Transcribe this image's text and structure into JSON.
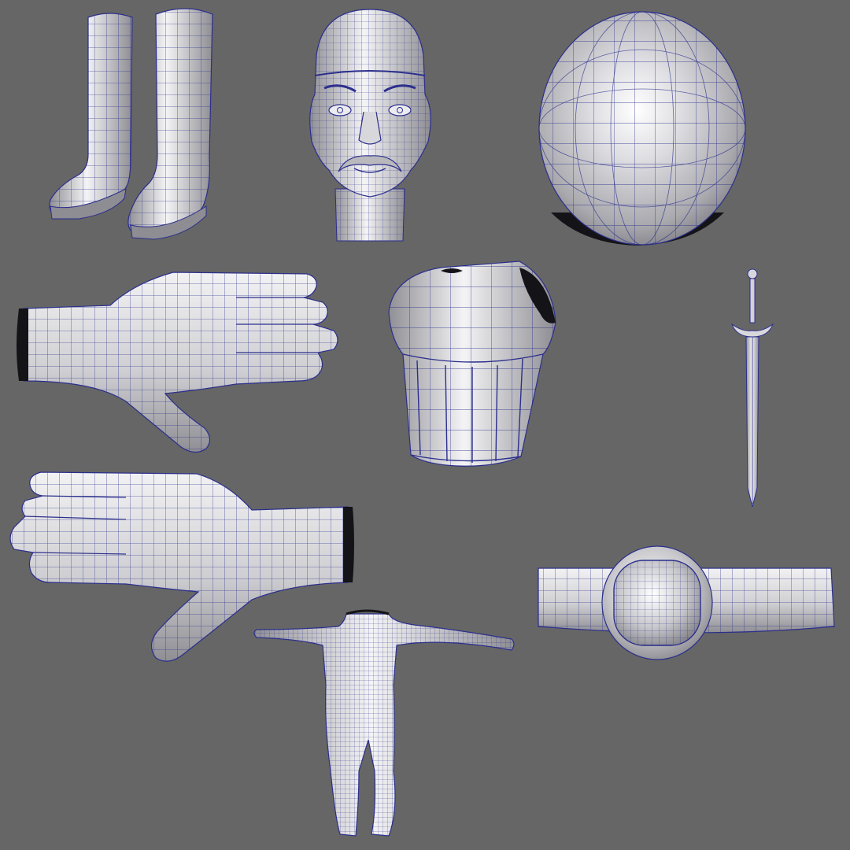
{
  "viewport": {
    "background": "#666666",
    "surface_color": "#bdbdc0",
    "surface_highlight": "#f6f6f8",
    "surface_shadow": "#7c7c82",
    "wire_color": "#2c2f8c",
    "cavity_color": "#141418"
  },
  "models": [
    {
      "name": "boots",
      "icon": "boots-wireframe-icon"
    },
    {
      "name": "head",
      "icon": "head-wireframe-icon"
    },
    {
      "name": "helmet-sphere",
      "icon": "sphere-wireframe-icon"
    },
    {
      "name": "right-hand",
      "icon": "hand-wireframe-icon"
    },
    {
      "name": "chest-armor",
      "icon": "armor-wireframe-icon"
    },
    {
      "name": "sword",
      "icon": "sword-wireframe-icon"
    },
    {
      "name": "left-hand",
      "icon": "hand-wireframe-icon"
    },
    {
      "name": "belt",
      "icon": "belt-wireframe-icon"
    },
    {
      "name": "body",
      "icon": "body-wireframe-icon"
    }
  ]
}
